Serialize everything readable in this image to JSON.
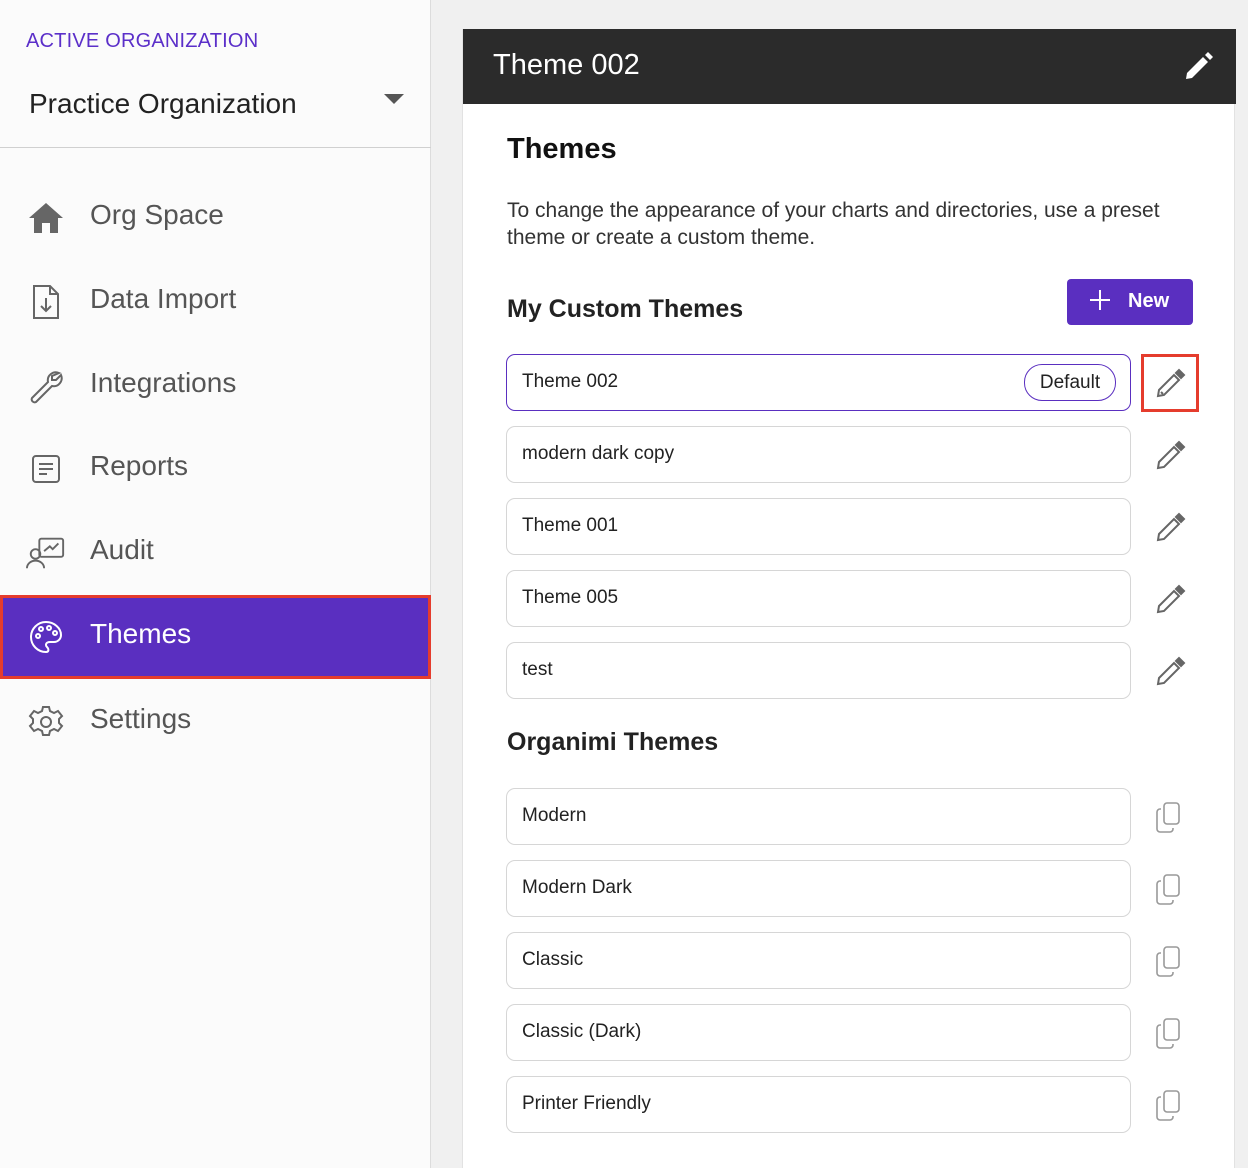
{
  "sidebar": {
    "org_label": "ACTIVE ORGANIZATION",
    "org_name": "Practice Organization",
    "items": [
      {
        "label": "Org Space",
        "icon": "home-icon"
      },
      {
        "label": "Data Import",
        "icon": "file-import-icon"
      },
      {
        "label": "Integrations",
        "icon": "wrench-icon"
      },
      {
        "label": "Reports",
        "icon": "report-icon"
      },
      {
        "label": "Audit",
        "icon": "audit-icon"
      },
      {
        "label": "Themes",
        "icon": "palette-icon",
        "active": true
      },
      {
        "label": "Settings",
        "icon": "gear-icon"
      }
    ]
  },
  "header": {
    "title": "Theme 002",
    "edit_icon": "pencil-icon"
  },
  "main": {
    "heading": "Themes",
    "description": "To change the appearance of your charts and directories, use a preset theme or create a custom theme.",
    "custom_title": "My Custom Themes",
    "new_label": "New",
    "custom_themes": [
      {
        "name": "Theme 002",
        "badge": "Default"
      },
      {
        "name": "modern dark copy"
      },
      {
        "name": "Theme 001"
      },
      {
        "name": "Theme 005"
      },
      {
        "name": "test"
      }
    ],
    "preset_title": "Organimi Themes",
    "preset_themes": [
      {
        "name": "Modern"
      },
      {
        "name": "Modern Dark"
      },
      {
        "name": "Classic"
      },
      {
        "name": "Classic (Dark)"
      },
      {
        "name": "Printer Friendly"
      }
    ]
  },
  "colors": {
    "accent": "#5a2fc0",
    "highlight": "#e53c2d",
    "topbar": "#2b2b2b"
  }
}
